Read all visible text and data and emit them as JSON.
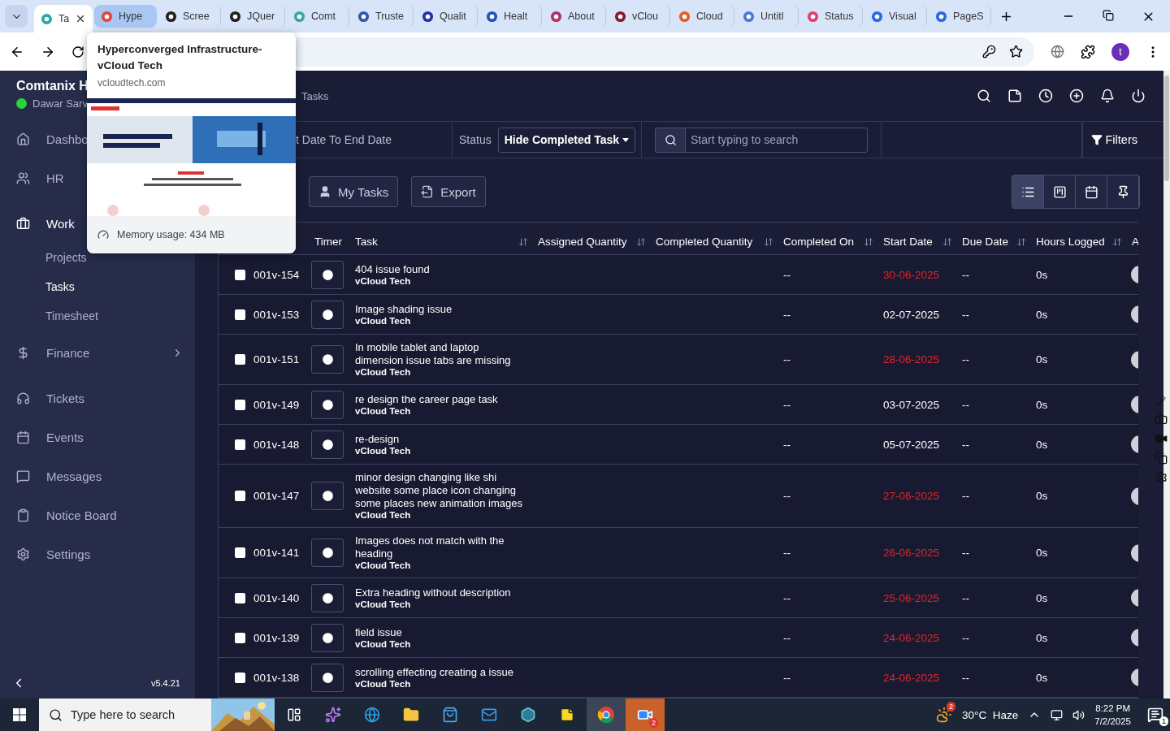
{
  "browser": {
    "tabs": [
      {
        "label": "Ta",
        "selected": true,
        "hovered": false
      },
      {
        "label": "Hype",
        "selected": false,
        "hovered": true
      },
      {
        "label": "Scree",
        "selected": false,
        "hovered": false
      },
      {
        "label": "JQuer",
        "selected": false,
        "hovered": false
      },
      {
        "label": "Comt",
        "selected": false,
        "hovered": false
      },
      {
        "label": "Truste",
        "selected": false,
        "hovered": false
      },
      {
        "label": "Qualit",
        "selected": false,
        "hovered": false
      },
      {
        "label": "Healt",
        "selected": false,
        "hovered": false
      },
      {
        "label": "About",
        "selected": false,
        "hovered": false
      },
      {
        "label": "vClou",
        "selected": false,
        "hovered": false
      },
      {
        "label": "Cloud",
        "selected": false,
        "hovered": false
      },
      {
        "label": "Untitl",
        "selected": false,
        "hovered": false
      },
      {
        "label": "Status",
        "selected": false,
        "hovered": false
      },
      {
        "label": "Visual",
        "selected": false,
        "hovered": false
      },
      {
        "label": "PageS",
        "selected": false,
        "hovered": false
      }
    ],
    "profile_initial": "t"
  },
  "tab_preview": {
    "title": "Hyperconverged Infrastructure-vCloud Tech",
    "domain": "vcloudtech.com",
    "memory": "Memory usage: 434 MB"
  },
  "sidebar": {
    "company": "Comtanix H",
    "user": "Dawar Sarv",
    "online": true,
    "items": [
      {
        "label": "Dashbo",
        "selected": false
      },
      {
        "label": "HR",
        "selected": false
      },
      {
        "label": "Work",
        "selected": true,
        "expanded": true,
        "children": [
          {
            "label": "Projects",
            "selected": false
          },
          {
            "label": "Tasks",
            "selected": true
          },
          {
            "label": "Timesheet",
            "selected": false
          }
        ]
      },
      {
        "label": "Finance",
        "selected": false,
        "expanded": false
      },
      {
        "label": "Tickets",
        "selected": false
      },
      {
        "label": "Events",
        "selected": false
      },
      {
        "label": "Messages",
        "selected": false
      },
      {
        "label": "Notice Board",
        "selected": false
      },
      {
        "label": "Settings",
        "selected": false
      }
    ],
    "version": "v5.4.21"
  },
  "header": {
    "breadcrumb": "Tasks"
  },
  "filters": {
    "date_range": "t Date To End Date",
    "status_label": "Status",
    "status_value": "Hide Completed Task",
    "search": {
      "placeholder": "Start typing to search"
    },
    "filters_button": "Filters"
  },
  "actions": [
    "My Tasks",
    "Export"
  ],
  "views": [
    {
      "selected": true
    },
    {
      "selected": false
    },
    {
      "selected": false
    },
    {
      "selected": false
    }
  ],
  "table": {
    "columns": [
      "Timer",
      "Task",
      "Assigned Quantity",
      "Completed Quantity",
      "Completed On",
      "Start Date",
      "Due Date",
      "Hours Logged",
      "A"
    ],
    "rows": [
      {
        "id": "001v-154",
        "title": "404 issue found",
        "client": "vCloud Tech",
        "completed_on": "--",
        "start_date": "30-06-2025",
        "overdue": true,
        "due_date": "--",
        "hours": "0s",
        "checked": false
      },
      {
        "id": "001v-153",
        "title": "Image shading issue",
        "client": "vCloud Tech",
        "completed_on": "--",
        "start_date": "02-07-2025",
        "overdue": false,
        "due_date": "--",
        "hours": "0s",
        "checked": false
      },
      {
        "id": "001v-151",
        "title": "In mobile tablet and laptop dimension issue tabs are missing",
        "client": "vCloud Tech",
        "completed_on": "--",
        "start_date": "28-06-2025",
        "overdue": true,
        "due_date": "--",
        "hours": "0s",
        "checked": false
      },
      {
        "id": "001v-149",
        "title": "re design the career page task",
        "client": "vCloud Tech",
        "completed_on": "--",
        "start_date": "03-07-2025",
        "overdue": false,
        "due_date": "--",
        "hours": "0s",
        "checked": false
      },
      {
        "id": "001v-148",
        "title": "re-design",
        "client": "vCloud Tech",
        "completed_on": "--",
        "start_date": "05-07-2025",
        "overdue": false,
        "due_date": "--",
        "hours": "0s",
        "checked": false
      },
      {
        "id": "001v-147",
        "title": "minor design changing like shi website some place icon changing some places new animation images",
        "client": "vCloud Tech",
        "completed_on": "--",
        "start_date": "27-06-2025",
        "overdue": true,
        "due_date": "--",
        "hours": "0s",
        "checked": false
      },
      {
        "id": "001v-141",
        "title": "Images does not match with the heading",
        "client": "vCloud Tech",
        "completed_on": "--",
        "start_date": "26-06-2025",
        "overdue": true,
        "due_date": "--",
        "hours": "0s",
        "checked": false
      },
      {
        "id": "001v-140",
        "title": "Extra heading without description",
        "client": "vCloud Tech",
        "completed_on": "--",
        "start_date": "25-06-2025",
        "overdue": true,
        "due_date": "--",
        "hours": "0s",
        "checked": false
      },
      {
        "id": "001v-139",
        "title": "field issue",
        "client": "vCloud Tech",
        "completed_on": "--",
        "start_date": "24-06-2025",
        "overdue": true,
        "due_date": "--",
        "hours": "0s",
        "checked": false
      },
      {
        "id": "001v-138",
        "title": "scrolling effecting creating a issue",
        "client": "vCloud Tech",
        "completed_on": "--",
        "start_date": "24-06-2025",
        "overdue": true,
        "due_date": "--",
        "hours": "0s",
        "checked": false
      }
    ]
  },
  "taskbar": {
    "search": {
      "placeholder": "Type here to search"
    },
    "zoom_badge": "2",
    "weather_badge": "2",
    "weather": "30°C  Haze",
    "time": "8:22 PM",
    "date": "7/2/2025",
    "notifications": "1"
  }
}
